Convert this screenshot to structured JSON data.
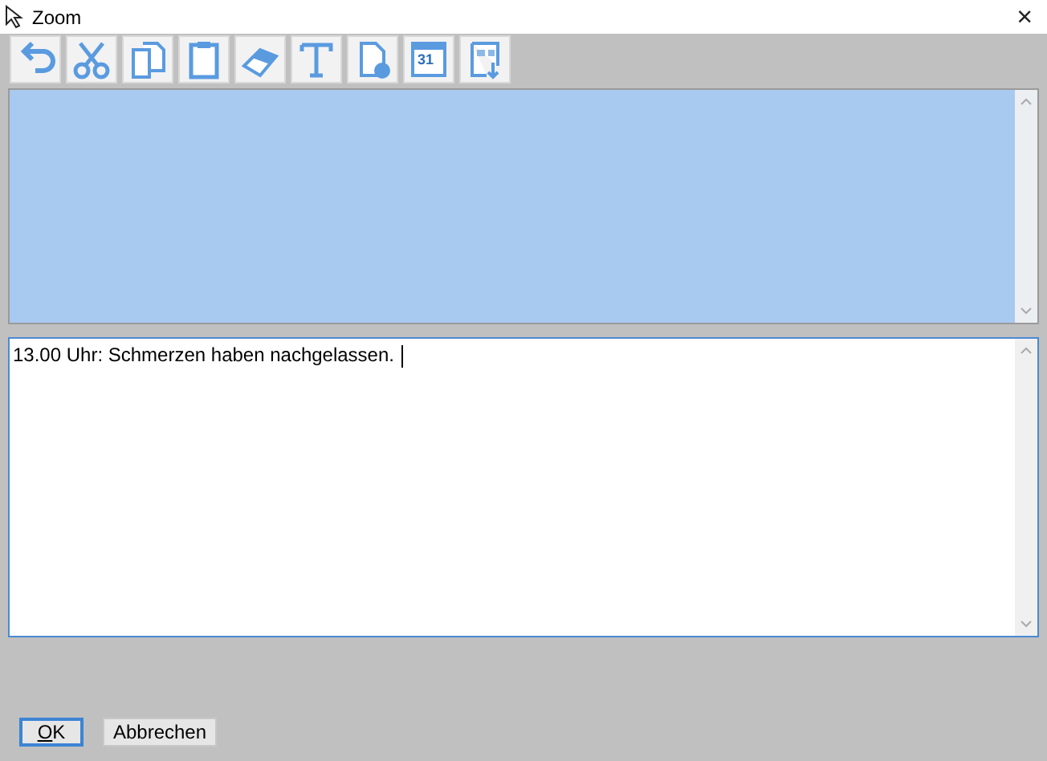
{
  "window": {
    "title": "Zoom",
    "close": "×"
  },
  "toolbar": [
    {
      "kind": "undo"
    },
    {
      "kind": "cut"
    },
    {
      "kind": "copy"
    },
    {
      "kind": "paste"
    },
    {
      "kind": "eraser"
    },
    {
      "kind": "text"
    },
    {
      "kind": "document"
    },
    {
      "kind": "calendar",
      "label": "31"
    },
    {
      "kind": "layout"
    }
  ],
  "upper_field": {
    "focused": false
  },
  "lower_field": {
    "value": "13.00 Uhr: Schmerzen haben nachgelassen.",
    "focused": true
  },
  "buttons": [
    {
      "label": "OK",
      "default": true
    },
    {
      "label": "Abbrechen",
      "default": false
    }
  ]
}
